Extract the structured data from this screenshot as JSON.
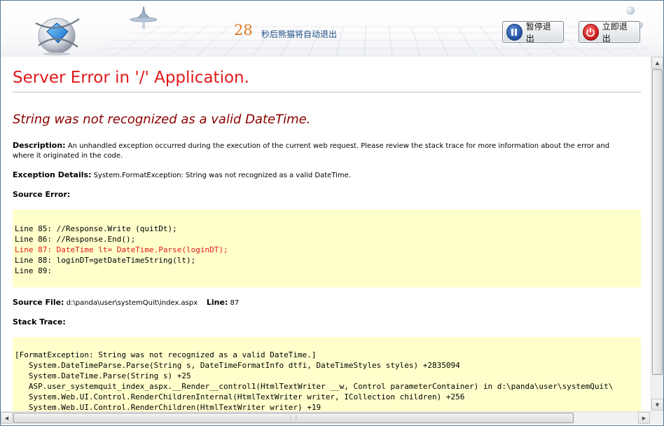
{
  "header": {
    "countdown_value": "28",
    "countdown_text": "秒后熊猫将自动退出",
    "pause_button": "暂停退出",
    "exit_button": "立即退出",
    "icons": {
      "pause": "pause-icon",
      "exit": "power-icon",
      "logo": "app-logo-icon"
    }
  },
  "error": {
    "title": "Server Error in '/' Application.",
    "subtitle": "String was not recognized as a valid DateTime.",
    "description_label": "Description:",
    "description_text": "An unhandled exception occurred during the execution of the current web request. Please review the stack trace for more information about the error and where it originated in the code.",
    "exception_label": "Exception Details:",
    "exception_text": "System.FormatException: String was not recognized as a valid DateTime.",
    "source_error_label": "Source Error:",
    "source_lines": [
      "Line 85: //Response.Write (quitDt);",
      "Line 86: //Response.End();",
      "Line 87: DateTime lt= DateTime.Parse(loginDT);",
      "Line 88: loginDT=getDateTimeString(lt);",
      "Line 89:"
    ],
    "source_file_label": "Source File:",
    "source_file_value": "d:\\panda\\user\\systemQuit\\index.aspx",
    "line_label": "Line:",
    "line_value": "87",
    "stack_trace_label": "Stack Trace:",
    "stack_lines": [
      "[FormatException: String was not recognized as a valid DateTime.]",
      "   System.DateTimeParse.Parse(String s, DateTimeFormatInfo dtfi, DateTimeStyles styles) +2835094",
      "   System.DateTime.Parse(String s) +25",
      "   ASP.user_systemquit_index_aspx.__Render__control1(HtmlTextWriter __w, Control parameterContainer) in d:\\panda\\user\\systemQuit\\",
      "   System.Web.UI.Control.RenderChildrenInternal(HtmlTextWriter writer, ICollection children) +256",
      "   System.Web.UI.Control.RenderChildren(HtmlTextWriter writer) +19"
    ]
  },
  "colors": {
    "title_red": "#e01919",
    "subtitle_darkred": "#8b0000",
    "code_background": "#ffffcc",
    "countdown_orange": "#e07a1e"
  }
}
